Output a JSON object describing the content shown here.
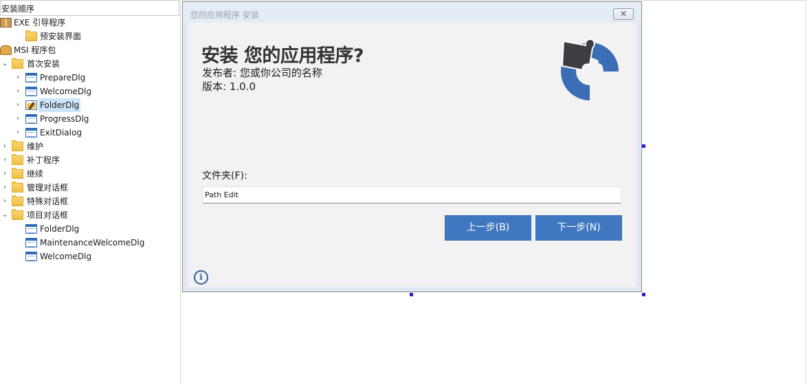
{
  "tree": {
    "header": "安装顺序",
    "items": [
      {
        "label": "EXE 引导程序",
        "icon": "package-icon",
        "chevron": "",
        "level": 0
      },
      {
        "label": "预安装界面",
        "icon": "folder-icon",
        "chevron": "",
        "level": 1
      },
      {
        "label": "MSI 程序包",
        "icon": "msi-package-icon",
        "chevron": "",
        "level": 0
      },
      {
        "label": "首次安装",
        "icon": "folder-icon",
        "chevron": "⌄",
        "level": 0
      },
      {
        "label": "PrepareDlg",
        "icon": "dialog-icon",
        "chevron": "›",
        "level": 1
      },
      {
        "label": "WelcomeDlg",
        "icon": "dialog-icon",
        "chevron": "›",
        "level": 1
      },
      {
        "label": "FolderDlg",
        "icon": "folder-dialog-icon",
        "chevron": "›",
        "level": 1,
        "selected": true
      },
      {
        "label": "ProgressDlg",
        "icon": "dialog-icon",
        "chevron": "›",
        "level": 1
      },
      {
        "label": "ExitDialog",
        "icon": "dialog-icon",
        "chevron": "›",
        "level": 1
      },
      {
        "label": "维护",
        "icon": "folder-icon",
        "chevron": "›",
        "level": 0
      },
      {
        "label": "补丁程序",
        "icon": "folder-icon",
        "chevron": "›",
        "level": 0
      },
      {
        "label": "继续",
        "icon": "folder-icon",
        "chevron": "›",
        "level": 0
      },
      {
        "label": "管理对话框",
        "icon": "folder-icon",
        "chevron": "›",
        "level": 0
      },
      {
        "label": "特殊对话框",
        "icon": "folder-icon",
        "chevron": "›",
        "level": 0
      },
      {
        "label": "项目对话框",
        "icon": "folder-icon",
        "chevron": "⌄",
        "level": 0
      },
      {
        "label": "FolderDlg",
        "icon": "dialog-icon",
        "chevron": "",
        "level": 1
      },
      {
        "label": "MaintenanceWelcomeDlg",
        "icon": "dialog-icon",
        "chevron": "",
        "level": 1
      },
      {
        "label": "WelcomeDlg",
        "icon": "dialog-icon",
        "chevron": "",
        "level": 1
      }
    ]
  },
  "dialog": {
    "title": "您的应用程序 安装",
    "close_label": "✕",
    "heading": "安装 您的应用程序?",
    "publisher": "发布者: 您或你公司的名称",
    "version": "版本: 1.0.0",
    "folder_label": "文件夹(F):",
    "path_value": "Path Edit",
    "back_label": "上一步(B)",
    "next_label": "下一步(N)",
    "info_glyph": "i"
  },
  "colors": {
    "accent_button": "#3f78c0",
    "logo_blue": "#3a6db5",
    "logo_dark": "#3d3d42",
    "selection": "#cce4f7",
    "handle": "#2a1fd0"
  }
}
